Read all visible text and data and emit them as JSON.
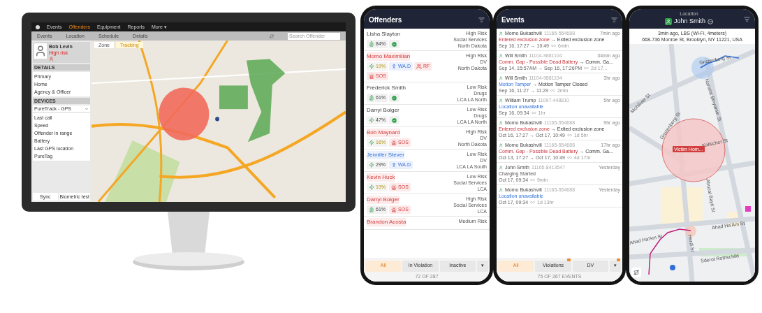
{
  "desktop": {
    "menu": [
      {
        "label": "Events",
        "selected": false
      },
      {
        "label": "Offenders",
        "selected": true
      },
      {
        "label": "Equipment",
        "selected": false
      },
      {
        "label": "Reports",
        "selected": false
      },
      {
        "label": "More ▾",
        "selected": false
      }
    ],
    "tabs": [
      {
        "label": "Events",
        "selected": false
      },
      {
        "label": "Location",
        "selected": false
      },
      {
        "label": "Schedule",
        "selected": false
      },
      {
        "label": "Details",
        "selected": false
      }
    ],
    "search": {
      "placeholder": "Search Offender"
    },
    "map_tools": [
      {
        "label": "Zone",
        "selected": false
      },
      {
        "label": "Tracking",
        "selected": true
      }
    ],
    "profile": {
      "name": "Bob Levin",
      "risk": "High risk"
    },
    "details": {
      "title": "DETAILS",
      "items": [
        "Primary",
        "Home",
        "Agency & Officer"
      ]
    },
    "devices": {
      "title": "DEVICES",
      "device": "PureTrack - GPS",
      "items": [
        "Last call",
        "Speed",
        "Offender in range",
        "Battery",
        "Last GPS location",
        "PureTag"
      ]
    },
    "buttons": [
      "Sync",
      "Biometric test"
    ]
  },
  "offenders": {
    "title": "Offenders",
    "rows": [
      {
        "name": "Lisha Slayton",
        "kind": "normal",
        "risk": "High Risk",
        "program": "Social Services",
        "region": "North Dakota",
        "badges": [
          {
            "kind": "battery",
            "label": "84%"
          },
          {
            "kind": "ok"
          }
        ]
      },
      {
        "name": "Momo Maximilian",
        "kind": "violation",
        "risk": "High Risk",
        "program": "DV",
        "region": "North Dakota",
        "badges": [
          {
            "kind": "charging",
            "label": "19%",
            "warning": true
          },
          {
            "kind": "wand",
            "label": "WA.D"
          },
          {
            "kind": "rf",
            "label": "RF"
          },
          {
            "kind": "sos",
            "label": "SOS"
          }
        ]
      },
      {
        "name": "Frederick Smith",
        "kind": "normal",
        "risk": "Low Risk",
        "program": "Drugs",
        "region": "LCA LA North",
        "badges": [
          {
            "kind": "battery",
            "label": "61%"
          },
          {
            "kind": "ok"
          }
        ]
      },
      {
        "name": "Darryl Bolger",
        "kind": "normal",
        "risk": "Low Risk",
        "program": "Drugs",
        "region": "LCA LA North",
        "badges": [
          {
            "kind": "charging",
            "label": "47%",
            "warning": false
          },
          {
            "kind": "ok"
          }
        ]
      },
      {
        "name": "Bob Maynard",
        "kind": "violation",
        "risk": "High Risk",
        "program": "DV",
        "region": "North Dakota",
        "badges": [
          {
            "kind": "charging",
            "label": "16%",
            "warning": true
          },
          {
            "kind": "sos",
            "label": "SOS"
          }
        ]
      },
      {
        "name": "Jennifer Stever",
        "kind": "notice",
        "risk": "Low Risk",
        "program": "DV",
        "region": "LCA LA South",
        "badges": [
          {
            "kind": "charging",
            "label": "29%",
            "warning": false
          },
          {
            "kind": "wand",
            "label": "WA.D"
          }
        ]
      },
      {
        "name": "Kevin Huck",
        "kind": "violation",
        "risk": "Low Risk",
        "program": "Social Services",
        "region": "LCA",
        "badges": [
          {
            "kind": "charging",
            "label": "19%",
            "warning": true
          },
          {
            "kind": "sos",
            "label": "SOS"
          }
        ]
      },
      {
        "name": "Darryl Bolger",
        "kind": "violation",
        "risk": "High Risk",
        "program": "Social Services",
        "region": "LCA",
        "badges": [
          {
            "kind": "battery",
            "label": "61%"
          },
          {
            "kind": "sos",
            "label": "SOS"
          }
        ]
      },
      {
        "name": "Brandon Acosta",
        "kind": "violation",
        "risk": "Medium Risk",
        "badges": []
      }
    ],
    "filters": [
      {
        "label": "All",
        "selected": true
      },
      {
        "label": "In Violation",
        "selected": false
      },
      {
        "label": "Inactive",
        "selected": false
      },
      {
        "label": "▾",
        "selected": false
      }
    ],
    "count": "72 OF 287"
  },
  "events": {
    "title": "Events",
    "rows": [
      {
        "person": "Momo Bukashvili",
        "id": "11165-554688",
        "time": "7min ago",
        "start": "Entered exclusion zone",
        "kind": "violation",
        "end": "→ Exited exclusion zone",
        "period": "Sep 16, 17:27 → 10:49",
        "duration": "6min"
      },
      {
        "person": "Will Smith",
        "id": "11104-9881104",
        "time": "34min ago",
        "start": "Comm. Gap - Possible Dead Battery",
        "kind": "violation",
        "end": "→ Comm. Ga...",
        "period": "Sep 14, 15:57AM → Sep 16, 17:26PM",
        "duration": "2d 17..."
      },
      {
        "person": "Will Smith",
        "id": "11104-9881104",
        "time": "3hr ago",
        "start": "Motion Tamper",
        "kind": "notice",
        "end": "→ Motion Tamper Closed",
        "period": "Sep 16, 11:27 → 11:29",
        "duration": "2min"
      },
      {
        "person": "William Trump",
        "id": "11097-448810",
        "time": "5hr ago",
        "start": "Location unavailable",
        "kind": "notice",
        "period": "Sep 16, 09:34",
        "duration": "1hr"
      },
      {
        "person": "Momo Bukashvili",
        "id": "11165-554688",
        "time": "9hr ago",
        "start": "Entered exclusion zone",
        "kind": "violation",
        "end": "→ Exited exclusion zone",
        "period": "Oct 16, 17:27 → Oct 17, 10:49",
        "duration": "1d 5hr"
      },
      {
        "person": "Momo Bukashvili",
        "id": "11165-554688",
        "time": "17hr ago",
        "start": "Comm. Gap - Possible Dead Battery",
        "kind": "violation",
        "end": "→ Comm. Ga...",
        "period": "Oct 13, 17:27 → Oct 17, 10:49",
        "duration": "4d 17hr"
      },
      {
        "person": "John Smith",
        "id": "11165-8413547",
        "time": "Yesterday",
        "start": "Charging Started",
        "kind": "normal",
        "period": "Oct 17, 09:34",
        "duration": "9min"
      },
      {
        "person": "Momo Bukashvili",
        "id": "11165-554688",
        "time": "Yesterday",
        "start": "Location unavailable",
        "kind": "notice",
        "period": "Oct 17, 09:34",
        "duration": "1d 13hr"
      }
    ],
    "filters": [
      {
        "label": "All",
        "selected": true,
        "badge": false
      },
      {
        "label": "Violations",
        "selected": false,
        "badge": true
      },
      {
        "label": "DV",
        "selected": false,
        "badge": false
      },
      {
        "label": "▾",
        "selected": false,
        "badge": true
      }
    ],
    "count": "75 OF 267 EVENTS"
  },
  "location": {
    "header": "Location",
    "name": "John Smith",
    "status": "3min ago, LBS (Wi-Fi, 4meters)",
    "address": "668-736 Monroe St, Brooklyn, NY 11221, USA",
    "zone_label": "Victim Hom...",
    "streets": [
      "Gruzenberg St",
      "Nahalat Binyamin St",
      "Mohiliver St",
      "Gruzenberg St",
      "Kalischer St",
      "Ahuzat Bayit St",
      "Ahad Ha'Am St",
      "Ahad Ha'Am St",
      "Herzl St",
      "Sderot Rothschild"
    ]
  }
}
